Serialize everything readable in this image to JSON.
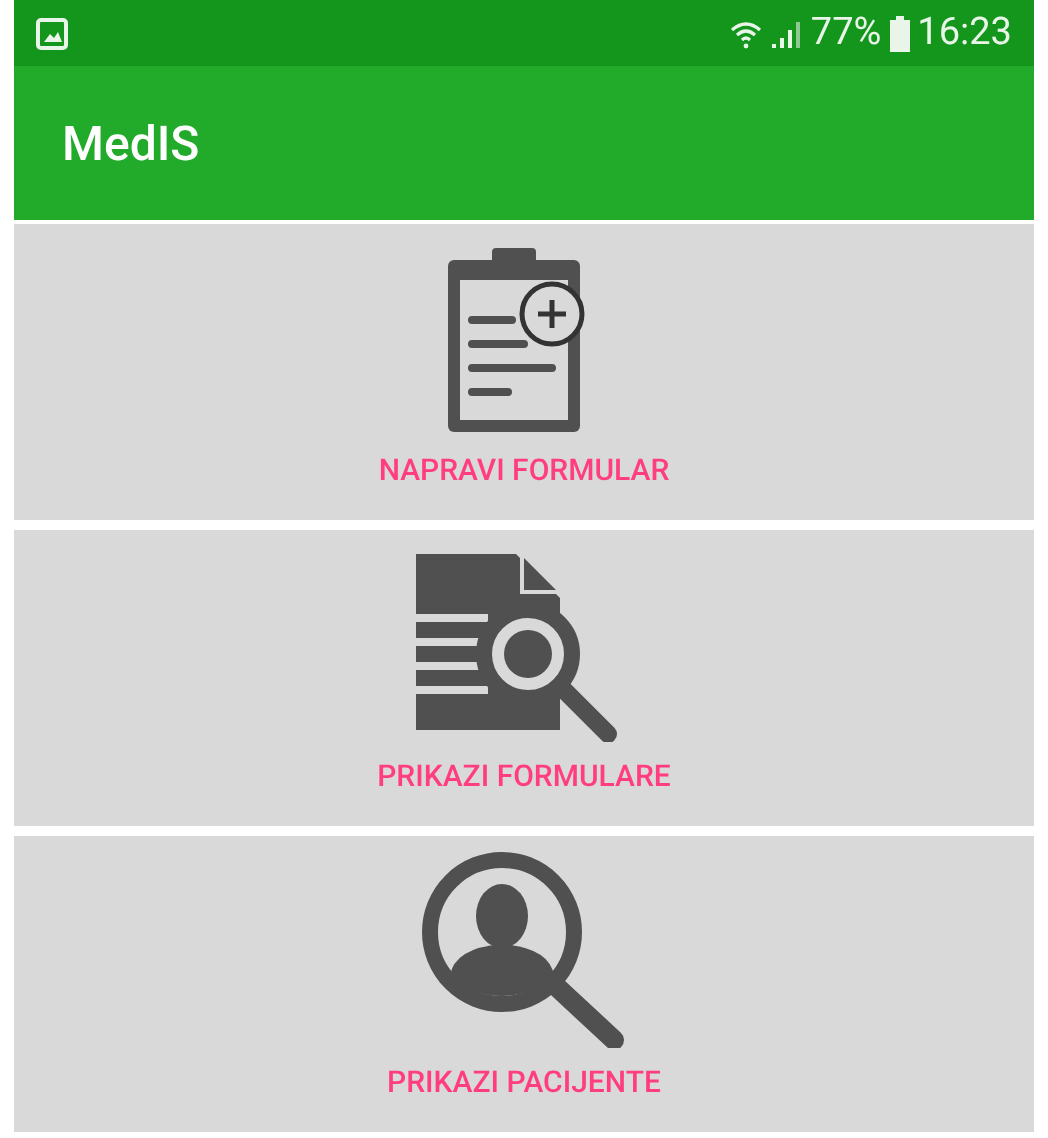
{
  "status_bar": {
    "battery": "77%",
    "time": "16:23"
  },
  "app_bar": {
    "title": "MedIS"
  },
  "actions": [
    {
      "kind": "new-form",
      "label": "NAPRAVI FORMULAR"
    },
    {
      "kind": "view-forms",
      "label": "PRIKAZI FORMULARE"
    },
    {
      "kind": "view-patients",
      "label": "PRIKAZI PACIJENTE"
    }
  ]
}
